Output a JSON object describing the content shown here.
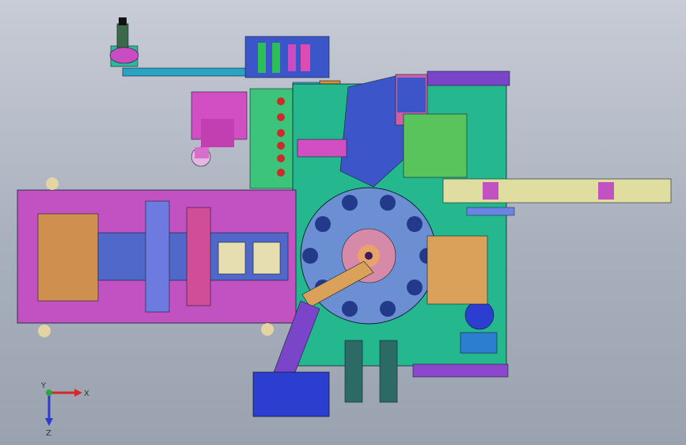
{
  "viewport": {
    "background_top": "#c7ccd6",
    "background_bottom": "#9aa2b0"
  },
  "triad": {
    "x_label": "X",
    "y_label": "Y",
    "z_label": "Z",
    "x_color": "#d22a2a",
    "y_color": "#2aa63a",
    "z_color": "#2a3ad2"
  }
}
